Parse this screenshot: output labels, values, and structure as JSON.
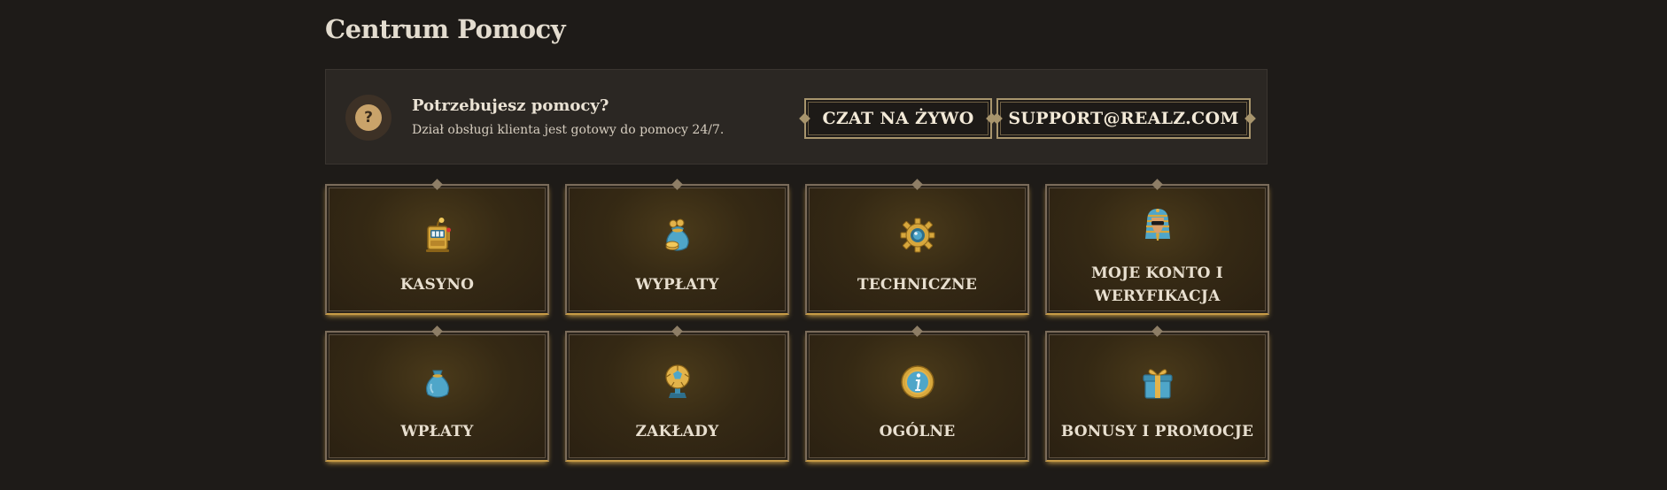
{
  "page": {
    "title": "Centrum Pomocy"
  },
  "help_banner": {
    "icon": "question-mark-icon",
    "icon_glyph": "?",
    "heading": "Potrzebujesz pomocy?",
    "subtext": "Dział obsługi klienta jest gotowy do pomocy 24/7.",
    "chat_button": "CZAT NA ŻYWO",
    "email_button": "SUPPORT@REALZ.COM"
  },
  "categories": [
    {
      "label": "KASYNO",
      "icon": "slot-machine-icon"
    },
    {
      "label": "WYPŁATY",
      "icon": "money-bag-coins-icon"
    },
    {
      "label": "TECHNICZNE",
      "icon": "gear-icon"
    },
    {
      "label": "MOJE KONTO I WERYFIKACJA",
      "label_line1": "MOJE KONTO I",
      "label_line2": "WERYFIKACJA",
      "icon": "pharaoh-icon"
    },
    {
      "label": "WPŁATY",
      "icon": "money-bag-icon"
    },
    {
      "label": "ZAKŁADY",
      "icon": "soccer-trophy-icon"
    },
    {
      "label": "OGÓLNE",
      "icon": "info-coin-icon"
    },
    {
      "label": "BONUSY I PROMOCJE",
      "icon": "gift-box-icon"
    }
  ],
  "colors": {
    "background": "#1e1b18",
    "banner": "#2b2723",
    "gold": "#c79b46",
    "accent_blue": "#4fa6c9"
  }
}
